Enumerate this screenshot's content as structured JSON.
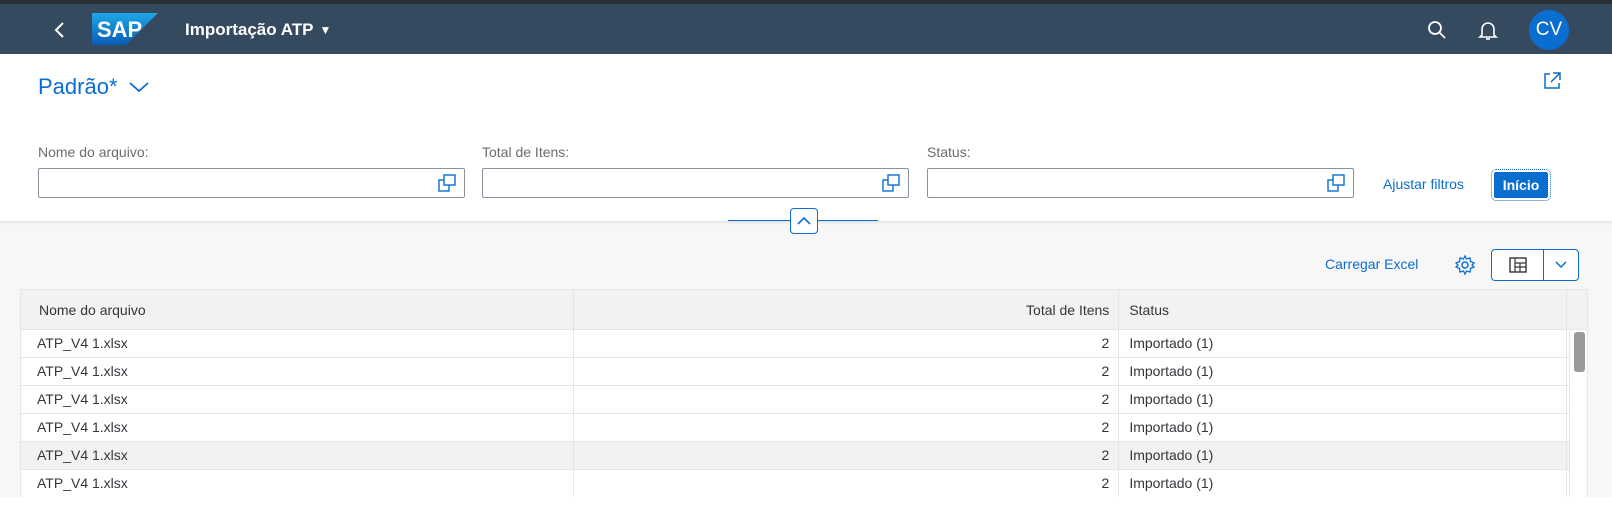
{
  "shell": {
    "app_title": "Importação ATP",
    "logo_text": "SAP",
    "avatar_initials": "CV"
  },
  "variant": {
    "name": "Padrão*"
  },
  "filters": [
    {
      "label": "Nome do arquivo:",
      "value": ""
    },
    {
      "label": "Total de Itens:",
      "value": ""
    },
    {
      "label": "Status:",
      "value": ""
    }
  ],
  "filterbar": {
    "adapt_label": "Ajustar filtros",
    "go_label": "Início"
  },
  "toolbar": {
    "upload_excel_label": "Carregar Excel"
  },
  "table": {
    "columns": [
      "Nome do arquivo",
      "Total de Itens",
      "Status"
    ],
    "rows": [
      {
        "file": "ATP_V4 1.xlsx",
        "total": "2",
        "status": "Importado (1)"
      },
      {
        "file": "ATP_V4 1.xlsx",
        "total": "2",
        "status": "Importado (1)"
      },
      {
        "file": "ATP_V4 1.xlsx",
        "total": "2",
        "status": "Importado (1)"
      },
      {
        "file": "ATP_V4 1.xlsx",
        "total": "2",
        "status": "Importado (1)"
      },
      {
        "file": "ATP_V4 1.xlsx",
        "total": "2",
        "status": "Importado (1)"
      },
      {
        "file": "ATP_V4 1.xlsx",
        "total": "2",
        "status": "Importado (1)"
      }
    ]
  },
  "colors": {
    "shell_bg": "#354a5f",
    "accent": "#0a6ed1",
    "text": "#32363a",
    "label": "#6a6d70"
  },
  "icons": [
    "back-icon",
    "sap-logo",
    "search-icon",
    "bell-icon",
    "share-icon",
    "value-help-icon",
    "collapse-icon",
    "gear-icon",
    "export-icon",
    "chevron-down-icon"
  ]
}
